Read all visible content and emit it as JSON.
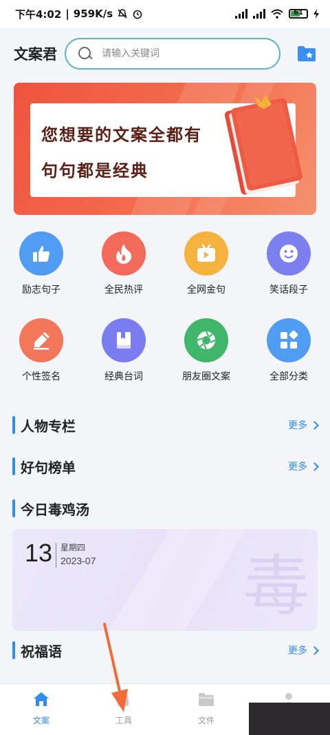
{
  "status_bar": {
    "time": "下午4:02",
    "speed": "959K/s",
    "battery": "61"
  },
  "header": {
    "app_name": "文案君",
    "search_placeholder": "请输入关键词"
  },
  "banner": {
    "line1": "您想要的文案全都有",
    "line2": "句句都是经典",
    "colors": {
      "start": "#f0533f",
      "end": "#f59170"
    }
  },
  "categories": [
    {
      "label": "励志句子",
      "icon": "thumbs-up-icon",
      "color": "#4f9cf2"
    },
    {
      "label": "全民热评",
      "icon": "flame-icon",
      "color": "#f36a5a"
    },
    {
      "label": "全网金句",
      "icon": "tv-play-icon",
      "color": "#f5b23c"
    },
    {
      "label": "笑话段子",
      "icon": "smile-icon",
      "color": "#7b7ff0"
    },
    {
      "label": "个性签名",
      "icon": "pencil-icon",
      "color": "#f2765a"
    },
    {
      "label": "经典台词",
      "icon": "book-icon",
      "color": "#7a7df0"
    },
    {
      "label": "朋友圈文案",
      "icon": "shutter-icon",
      "color": "#3fb66a"
    },
    {
      "label": "全部分类",
      "icon": "grid-icon",
      "color": "#4f9cf2"
    }
  ],
  "sections": {
    "people": {
      "title": "人物专栏",
      "more": "更多"
    },
    "ranking": {
      "title": "好句榜单",
      "more": "更多"
    },
    "daily": {
      "title": "今日毒鸡汤"
    },
    "blessing": {
      "title": "祝福语",
      "more": "更多"
    }
  },
  "daily_card": {
    "day": "13",
    "weekday": "星期四",
    "year_month": "2023-07",
    "watermark": "毒"
  },
  "bottom_nav": [
    {
      "label": "文案",
      "icon": "home-icon",
      "active": true
    },
    {
      "label": "工具",
      "icon": "tool-icon",
      "active": false
    },
    {
      "label": "文件",
      "icon": "folder-icon",
      "active": false
    },
    {
      "label": "",
      "icon": "profile-icon",
      "active": false
    }
  ],
  "accent_color": "#2d8df0",
  "annotation_color": "#f26a35"
}
